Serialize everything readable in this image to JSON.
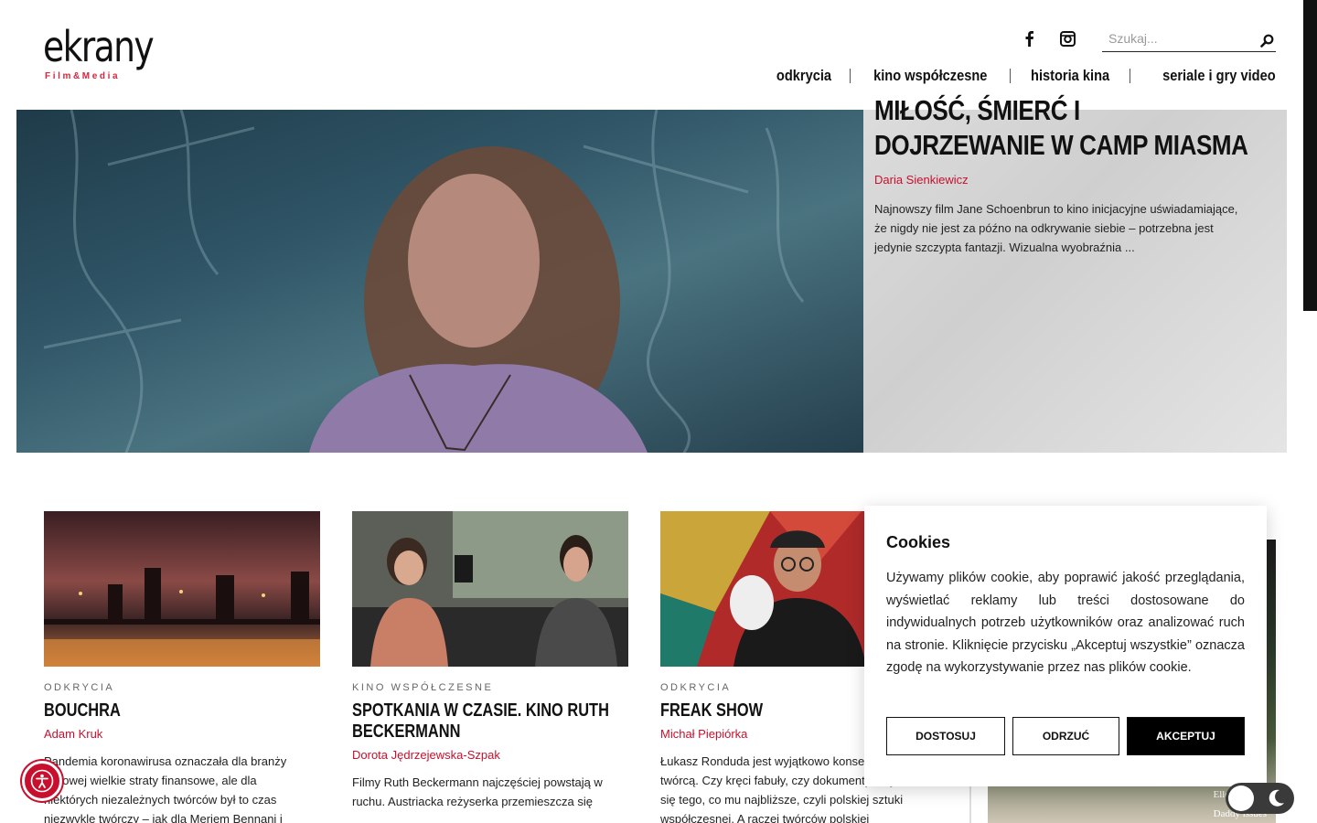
{
  "header": {
    "logo_text": "ekrany",
    "logo_subtext": "Film&Media",
    "social": [
      {
        "name": "facebook-icon"
      },
      {
        "name": "instagram-icon"
      }
    ],
    "search": {
      "placeholder": "Szukaj..."
    },
    "nav": [
      "odkrycia",
      "kino współczesne",
      "historia kina",
      "seriale i gry video"
    ]
  },
  "hero": {
    "title": "MIŁOŚĆ, ŚMIERĆ I DOJRZEWANIE W CAMP MIASMA",
    "author": "Daria Sienkiewicz",
    "excerpt": "Najnowszy film Jane Schoenbrun to kino inicjacyjne uświadamiające, że nigdy nie jest za późno na odkrywanie siebie – potrzebna jest jedynie szczypta fantazji. Wizualna wyobraźnia ..."
  },
  "cards": [
    {
      "category": "ODKRYCIA",
      "title": "BOUCHRA",
      "author": "Adam Kruk",
      "excerpt": "Pandemia koronawirusa oznaczała dla branży filmowej wielkie straty finansowe, ale dla niektórych niezależnych twórców był to czas niezwykle twórczy – jak dla Meriem Bennani i"
    },
    {
      "category": "KINO WSPÓŁCZESNE",
      "title": "SPOTKANIA W CZASIE. KINO RUTH BECKERMANN",
      "author": "Dorota Jędrzejewska-Szpak",
      "excerpt": "Filmy Ruth Beckermann najczęściej powstają w ruchu. Austriacka reżyserka przemieszcza się"
    },
    {
      "category": "ODKRYCIA",
      "title": "FREAK SHOW",
      "author": "Michał Piepiórka",
      "excerpt": "Łukasz Ronduda jest wyjątkowo konsekwentnym twórcą. Czy kręci fabuły, czy dokumenty, trzyma się tego, co mu najbliższe, czyli polskiej sztuki współczesnej. A raczej twórców polskiej"
    }
  ],
  "side_image": {
    "caption1": "Elle Fanning",
    "caption2": "Daddy issues"
  },
  "cookie": {
    "title": "Cookies",
    "text": "Używamy plików cookie, aby poprawić jakość przeglądania, wyświetlać reklamy lub treści dostosowane do indywidualnych potrzeb użytkowników oraz analizować ruch na stronie. Kliknięcie przycisku „Akceptuj wszystkie” oznacza zgodę na wykorzystywanie przez nas plików cookie.",
    "customize": "DOSTOSUJ",
    "reject": "ODRZUĆ",
    "accept": "AKCEPTUJ"
  },
  "colors": {
    "accent": "#c8102e",
    "text": "#111111"
  }
}
